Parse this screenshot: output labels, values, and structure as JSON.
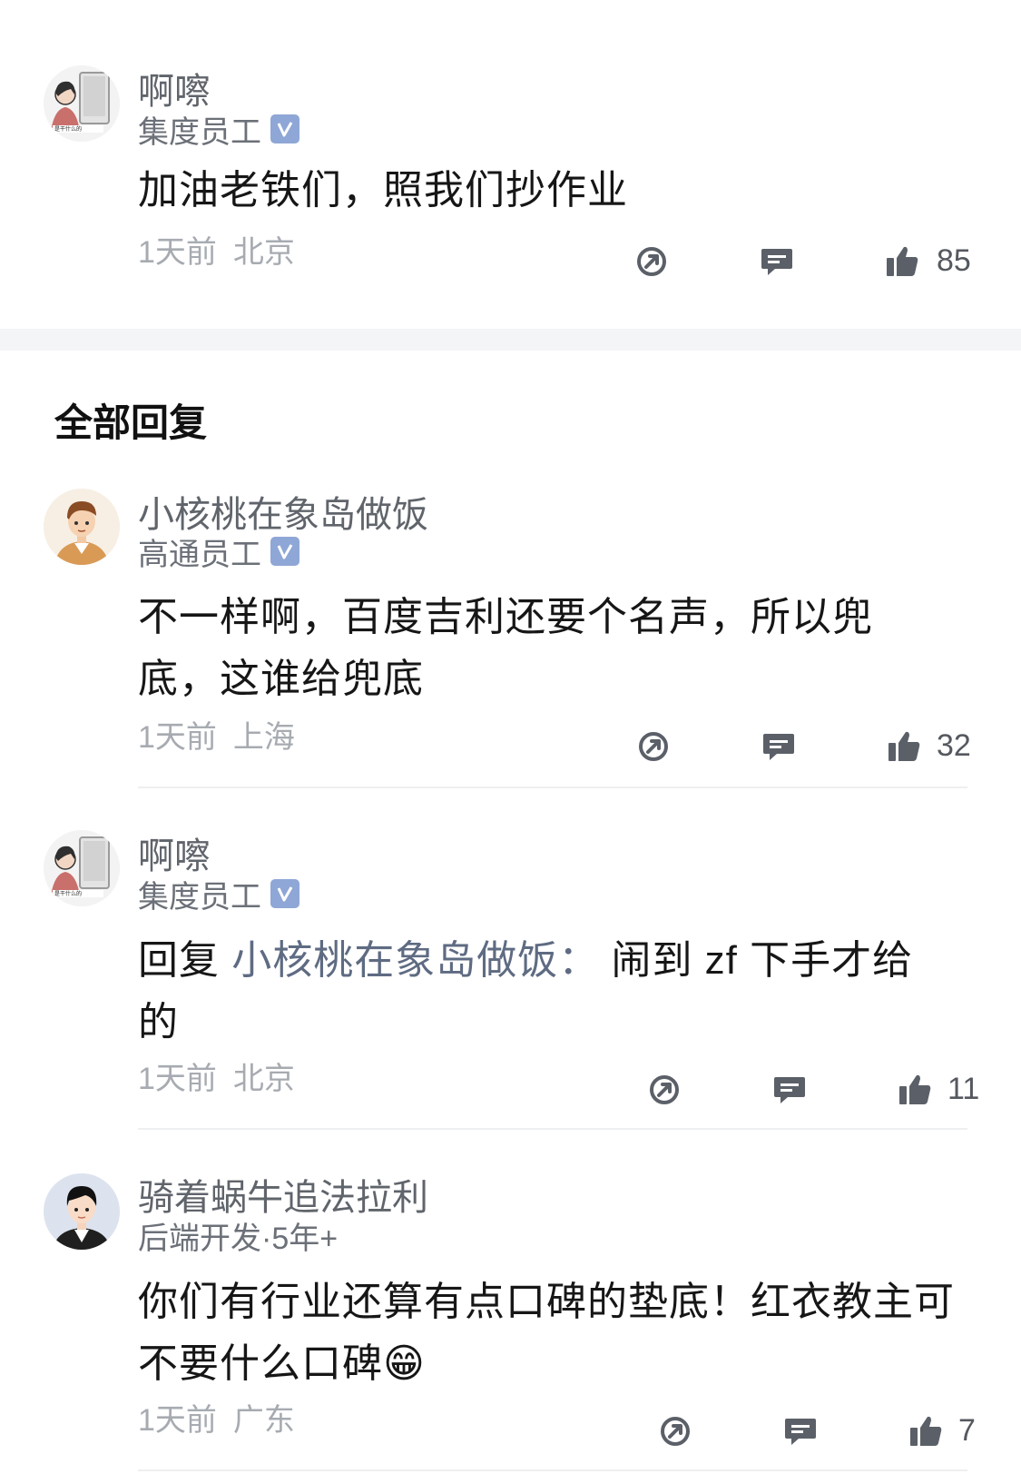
{
  "main_comment": {
    "user": "啊嚓",
    "tag": "集度员工",
    "verified": true,
    "text": "加油老铁们，照我们抄作业",
    "time": "1天前",
    "location": "北京",
    "likes": "85",
    "avatar": "woman-with-monitor-avatar"
  },
  "section_title": "全部回复",
  "replies": [
    {
      "user": "小核桃在象岛做饭",
      "tag": "高通员工",
      "verified": true,
      "text": "不一样啊，百度吉利还要个名声，所以兜底，这谁给兜底",
      "time": "1天前",
      "location": "上海",
      "likes": "32",
      "avatar": "man-cartoon-avatar"
    },
    {
      "user": "啊嚓",
      "tag": "集度员工",
      "verified": true,
      "reply_prefix": "回复 ",
      "reply_target": "小核桃在象岛做饭：",
      "text": " 闹到 zf 下手才给的",
      "time": "1天前",
      "location": "北京",
      "likes": "11",
      "avatar": "woman-with-monitor-avatar"
    },
    {
      "user": "骑着蜗牛追法拉利",
      "tag": "后端开发·5年+",
      "verified": false,
      "text": "你们有行业还算有点口碑的垫底！红衣教主可不要什么口碑",
      "emoji": "😁",
      "time": "1天前",
      "location": "广东",
      "likes": "7",
      "avatar": "boy-cartoon-avatar"
    }
  ],
  "icons": {
    "share": "share-icon",
    "comment": "comment-icon",
    "like": "thumbs-up-icon",
    "verified": "verified-badge-icon"
  },
  "colors": {
    "username": "#60646b",
    "meta": "#a7abb1",
    "icon": "#5b6068",
    "verified_badge": "#8fa7d6",
    "reply_target": "#5e6b82"
  }
}
